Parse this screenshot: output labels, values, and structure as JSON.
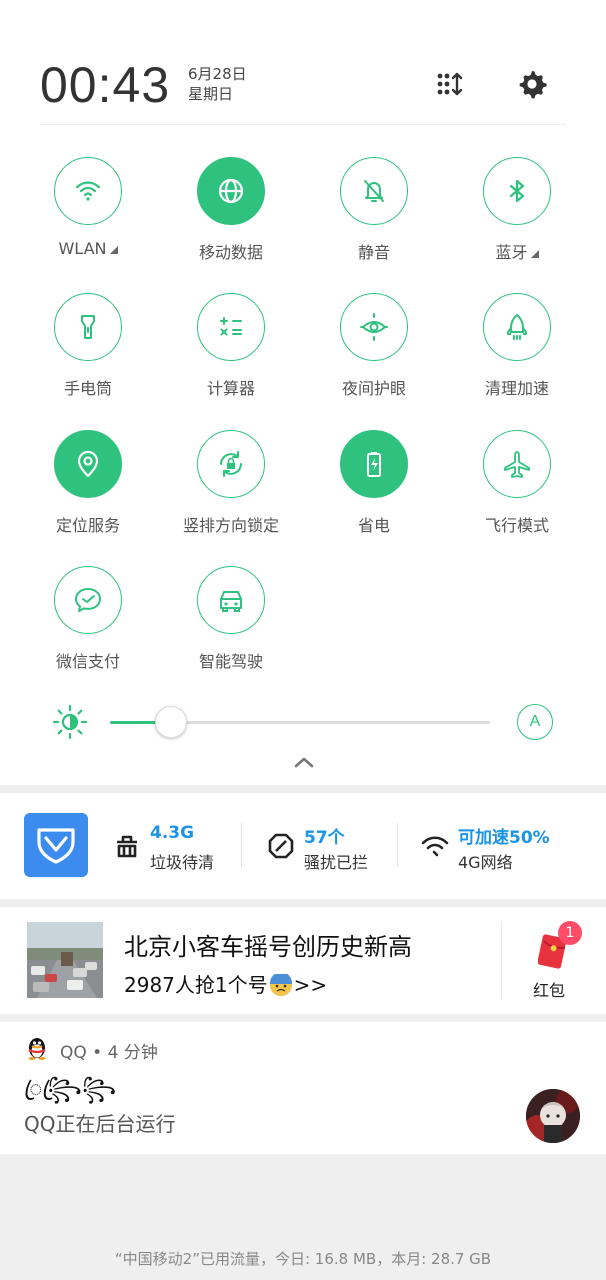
{
  "header": {
    "time": "00:43",
    "date": "6月28日",
    "weekday": "星期日"
  },
  "tiles": [
    {
      "label": "WLAN",
      "icon": "wifi-icon",
      "on": false,
      "expand": true
    },
    {
      "label": "移动数据",
      "icon": "globe-icon",
      "on": true,
      "expand": false
    },
    {
      "label": "静音",
      "icon": "bell-off-icon",
      "on": false,
      "expand": false
    },
    {
      "label": "蓝牙",
      "icon": "bluetooth-icon",
      "on": false,
      "expand": true
    },
    {
      "label": "手电筒",
      "icon": "flashlight-icon",
      "on": false,
      "expand": false
    },
    {
      "label": "计算器",
      "icon": "calculator-icon",
      "on": false,
      "expand": false
    },
    {
      "label": "夜间护眼",
      "icon": "eye-care-icon",
      "on": false,
      "expand": false
    },
    {
      "label": "清理加速",
      "icon": "rocket-icon",
      "on": false,
      "expand": false
    },
    {
      "label": "定位服务",
      "icon": "location-icon",
      "on": true,
      "expand": false
    },
    {
      "label": "竖排方向锁定",
      "icon": "rotation-lock-icon",
      "on": false,
      "expand": false
    },
    {
      "label": "省电",
      "icon": "battery-saver-icon",
      "on": true,
      "expand": false
    },
    {
      "label": "飞行模式",
      "icon": "airplane-icon",
      "on": false,
      "expand": false
    },
    {
      "label": "微信支付",
      "icon": "wechat-pay-icon",
      "on": false,
      "expand": false
    },
    {
      "label": "智能驾驶",
      "icon": "car-icon",
      "on": false,
      "expand": false
    }
  ],
  "brightness": {
    "level": 0.12,
    "auto_label": "A"
  },
  "security": {
    "stats": [
      {
        "value": "4.3G",
        "label": "垃圾待清"
      },
      {
        "value": "57个",
        "label": "骚扰已拦"
      },
      {
        "value": "可加速50%",
        "label": "4G网络"
      }
    ]
  },
  "news": {
    "title": "北京小客车摇号创历史新高",
    "subtitle_pre": "2987人抢1个号",
    "subtitle_post": ">>",
    "badge": "1",
    "redpack_label": "红包"
  },
  "qq": {
    "meta": "QQ • 4 分钟",
    "sender": "ꦿ꧂ꦿ꧂",
    "message": "QQ正在后台运行"
  },
  "footer": "“中国移动2”已用流量，今日: 16.8 MB，本月: 28.7 GB",
  "colors": {
    "accent": "#2ec27e",
    "link": "#1a94e8",
    "badge": "#ff4d6a"
  }
}
